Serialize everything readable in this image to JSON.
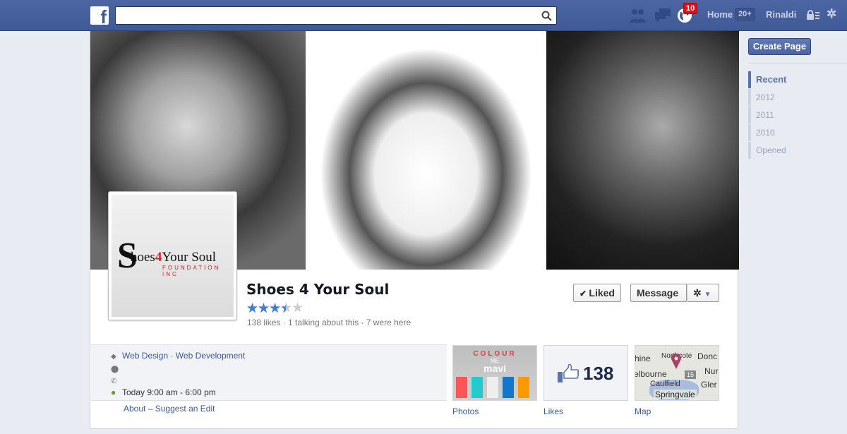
{
  "topbar": {
    "logo": "f",
    "search_placeholder": "",
    "notifications_count": "10",
    "home_label": "Home",
    "home_count": "20+",
    "user_name": "Rinaldi"
  },
  "page": {
    "name": "Shoes 4 Your Soul",
    "rating": 3.5,
    "rating_max": 5,
    "stars": "★★★★★",
    "stats": "138 likes · 1 talking about this · 7 were here",
    "logo": {
      "initial": "S",
      "text_a": "hoes",
      "text_heart": "4",
      "text_b": "Your Soul",
      "sub": "FOUNDATION INC"
    },
    "liked_label": "Liked",
    "message_label": "Message"
  },
  "info": {
    "categories": "Web Design · Web Development",
    "hours": "Today 9:00 am - 6:00 pm",
    "about": "About",
    "suggest": "Suggest an Edit",
    "separator": "–"
  },
  "tiles": [
    {
      "label": "Photos",
      "img_text_a": "COLOUR",
      "img_text_b": "ME",
      "img_text_c": "mavi"
    },
    {
      "label": "Likes",
      "count": "138"
    },
    {
      "label": "Map",
      "places": [
        "hine",
        "Northcote",
        "Donc",
        "Nur",
        "elbourne",
        "Caulfield",
        "Gler",
        "Springvale"
      ],
      "road": "15"
    }
  ],
  "sidebar": {
    "create_page": "Create Page",
    "timeline": [
      "Recent",
      "2012",
      "2011",
      "2010",
      "Opened"
    ]
  },
  "colors": {
    "brand": "#3b5998",
    "star": "#3b7fd8",
    "open": "#5ba61f",
    "badge": "#e0101a"
  }
}
